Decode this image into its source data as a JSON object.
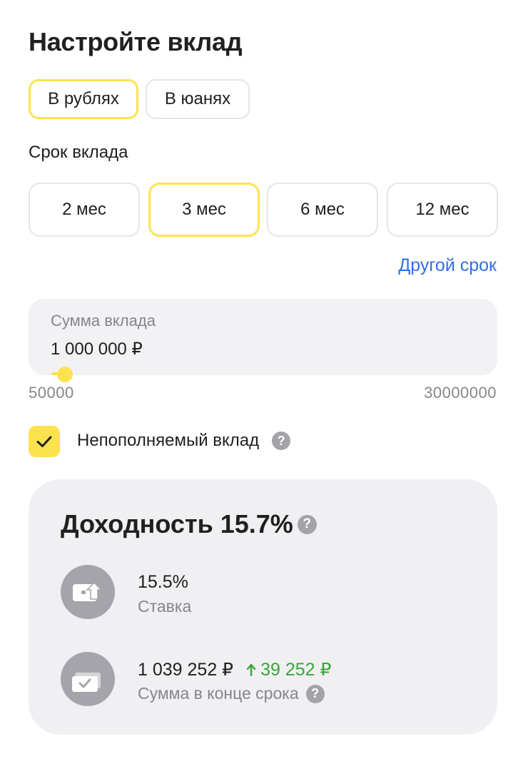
{
  "title": "Настройте вклад",
  "currency": {
    "options": [
      {
        "label": "В рублях",
        "active": true
      },
      {
        "label": "В юанях",
        "active": false
      }
    ]
  },
  "term": {
    "label": "Срок вклада",
    "options": [
      {
        "label": "2 мес",
        "active": false
      },
      {
        "label": "3 мес",
        "active": true
      },
      {
        "label": "6 мес",
        "active": false
      },
      {
        "label": "12 мес",
        "active": false
      }
    ],
    "other_link": "Другой срок"
  },
  "amount": {
    "label": "Сумма вклада",
    "value": "1 000 000 ₽",
    "min": "50000",
    "max": "30000000",
    "slider_fraction": 0.032
  },
  "non_replenishable": {
    "label": "Непополняемый вклад",
    "checked": true
  },
  "yield": {
    "title": "Доходность 15.7%",
    "rate_value": "15.5%",
    "rate_label": "Ставка",
    "end_amount": "1 039 252 ₽",
    "gain": "39 252 ₽",
    "end_label": "Сумма в конце срока"
  },
  "colors": {
    "accent": "#fde24f",
    "link": "#2f6fe8",
    "gain": "#3aa53a"
  },
  "icons": [
    "question-icon",
    "check-icon",
    "wallet-icon",
    "card-check-icon",
    "arrow-up-icon"
  ]
}
